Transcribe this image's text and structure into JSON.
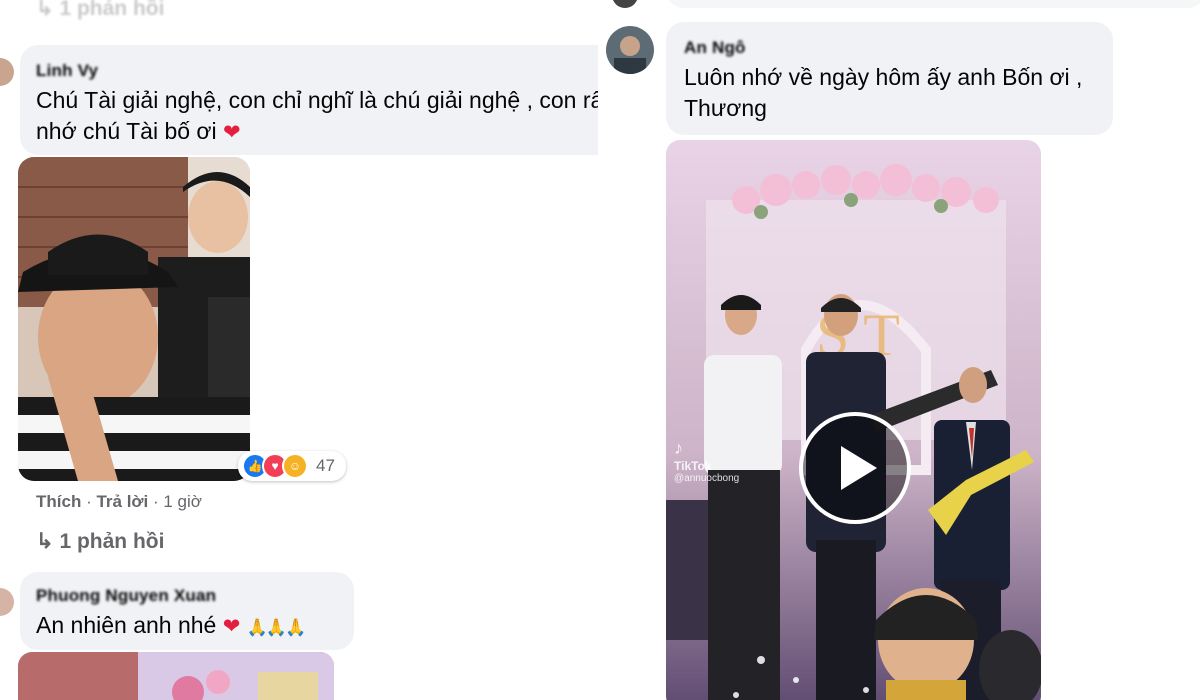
{
  "left": {
    "top_reply_link": "1 phản hồi",
    "comment1": {
      "author": "Linh Vy",
      "text_line1": "Chú Tài giải nghệ, con chỉ nghĩ là chú giải nghệ , con rấ",
      "text_line2": "nhớ chú Tài bố ơi",
      "reaction_count": "47",
      "like_label": "Thích",
      "reply_label": "Trả lời",
      "time_label": "1 giờ",
      "replies_link": "1 phản hồi"
    },
    "comment2": {
      "author": "Phuong Nguyen Xuan",
      "text": "An nhiên anh nhé"
    }
  },
  "right": {
    "comment": {
      "author": "An Ngô",
      "text_line1": "Luôn nhớ về ngày hôm ấy anh Bốn ơi ,",
      "text_line2": "Thương"
    },
    "video": {
      "watermark": "TikTok",
      "handle": "@annuocbong"
    }
  },
  "icons": [
    "reply-arrow-icon",
    "heart-emoji-icon",
    "pray-emoji-icon",
    "like-reaction-icon",
    "love-reaction-icon",
    "care-reaction-icon",
    "play-icon",
    "tiktok-logo-icon"
  ],
  "colors": {
    "bubble": "#f0f2f5",
    "meta": "#65676b",
    "heart": "#e41e3f",
    "like": "#1877f2",
    "love": "#f33e58"
  }
}
